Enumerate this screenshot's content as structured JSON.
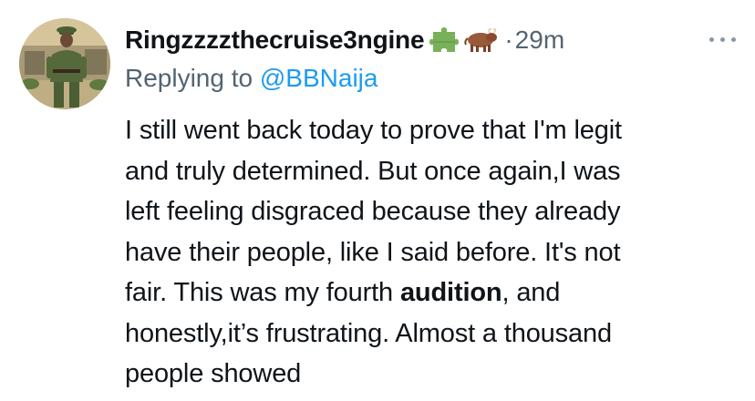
{
  "tweet": {
    "display_name": "Ringzzzzthecruise3ngine",
    "badges": [
      "puzzle-piece-emoji",
      "ox-emoji"
    ],
    "separator": "·",
    "time": "29m",
    "more_icon": "more-horizontal-icon",
    "replying_prefix": "Replying to",
    "replying_handle": "@BBNaija",
    "body": {
      "line1": "I still went back today to prove that I'm legit",
      "line2": "and truly determined. But once again,I was",
      "line3": "left feeling disgraced because they already",
      "line4": "have their people, like I said before. It's not",
      "line5_a": "fair. This was my fourth ",
      "line5_bold": "audition",
      "line5_b": ", and",
      "line6": "honestly,it’s frustrating. Almost a thousand",
      "line7": "people showed"
    }
  },
  "colors": {
    "text": "#0f1419",
    "secondary": "#536471",
    "link": "#1d9bf0"
  }
}
